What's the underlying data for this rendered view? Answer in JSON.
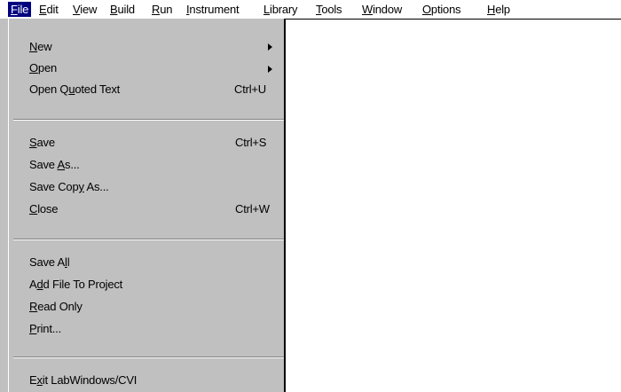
{
  "menubar": {
    "items": [
      {
        "pre": "",
        "key": "F",
        "post": "ile"
      },
      {
        "pre": "",
        "key": "E",
        "post": "dit"
      },
      {
        "pre": "",
        "key": "V",
        "post": "iew"
      },
      {
        "pre": "",
        "key": "B",
        "post": "uild"
      },
      {
        "pre": "",
        "key": "R",
        "post": "un"
      },
      {
        "pre": "",
        "key": "I",
        "post": "nstrument"
      },
      {
        "pre": "",
        "key": "L",
        "post": "ibrary"
      },
      {
        "pre": "",
        "key": "T",
        "post": "ools"
      },
      {
        "pre": "",
        "key": "W",
        "post": "indow"
      },
      {
        "pre": "",
        "key": "O",
        "post": "ptions"
      },
      {
        "pre": "",
        "key": "H",
        "post": "elp"
      }
    ]
  },
  "file_menu": {
    "items": [
      {
        "pre": "",
        "key": "N",
        "post": "ew",
        "shortcut": ""
      },
      {
        "pre": "",
        "key": "O",
        "post": "pen",
        "shortcut": ""
      },
      {
        "pre": "Open Q",
        "key": "u",
        "post": "oted Text",
        "shortcut": "Ctrl+U"
      },
      {
        "pre": "",
        "key": "S",
        "post": "ave",
        "shortcut": "Ctrl+S"
      },
      {
        "pre": "Save ",
        "key": "A",
        "post": "s...",
        "shortcut": ""
      },
      {
        "pre": "Save Cop",
        "key": "y",
        "post": " As...",
        "shortcut": ""
      },
      {
        "pre": "",
        "key": "C",
        "post": "lose",
        "shortcut": "Ctrl+W"
      },
      {
        "pre": "Save A",
        "key": "l",
        "post": "l",
        "shortcut": ""
      },
      {
        "pre": "A",
        "key": "d",
        "post": "d File To Project",
        "shortcut": ""
      },
      {
        "pre": "",
        "key": "R",
        "post": "ead Only",
        "shortcut": ""
      },
      {
        "pre": "",
        "key": "P",
        "post": "rint...",
        "shortcut": ""
      },
      {
        "pre": "E",
        "key": "x",
        "post": "it LabWindows/CVI",
        "shortcut": ""
      }
    ]
  }
}
